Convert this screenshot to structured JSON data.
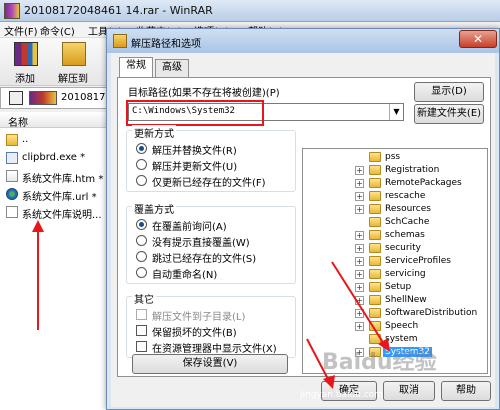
{
  "main": {
    "title": "20108172048461 14.rar - WinRAR",
    "menu": [
      "文件(F)",
      "命令(C)",
      "工具(S)",
      "收藏夹(O)",
      "选项(N)",
      "帮助(H)"
    ],
    "toolbar": {
      "add_label": "添加",
      "extract_label": "解压到"
    },
    "address": "2010817",
    "list_header": "名称",
    "files": [
      {
        "name": ".."
      },
      {
        "name": "clipbrd.exe *"
      },
      {
        "name": "系统文件库.htm *"
      },
      {
        "name": "系统文件库.url *"
      },
      {
        "name": "系统文件库说明..."
      }
    ]
  },
  "dialog": {
    "title": "解压路径和选项",
    "close_label": "✕",
    "tabs": [
      "常规",
      "高级"
    ],
    "target_path_label": "目标路径(如果不存在将被创建)(P)",
    "target_path": "C:\\Windows\\System32",
    "show_button": "显示(D)",
    "new_folder_button": "新建文件夹(E)",
    "update_mode": {
      "title": "更新方式",
      "options": [
        "解压并替换文件(R)",
        "解压并更新文件(U)",
        "仅更新已经存在的文件(F)"
      ]
    },
    "overwrite_mode": {
      "title": "覆盖方式",
      "options": [
        "在覆盖前询问(A)",
        "没有提示直接覆盖(W)",
        "跳过已经存在的文件(S)",
        "自动重命名(N)"
      ]
    },
    "misc": {
      "title": "其它",
      "options": [
        "解压文件到子目录(L)",
        "保留损坏的文件(B)",
        "在资源管理器中显示文件(X)"
      ]
    },
    "save_settings_button": "保存设置(V)",
    "tree": [
      "pss",
      "Registration",
      "RemotePackages",
      "rescache",
      "Resources",
      "SchCache",
      "schemas",
      "security",
      "ServiceProfiles",
      "servicing",
      "Setup",
      "ShellNew",
      "SoftwareDistribution",
      "Speech",
      "system",
      "System32"
    ],
    "ok_button": "确定",
    "cancel_button": "取消",
    "help_button": "帮助"
  },
  "watermark": "jingyan.baidu.com",
  "watermark_logo": "Baidu经验"
}
